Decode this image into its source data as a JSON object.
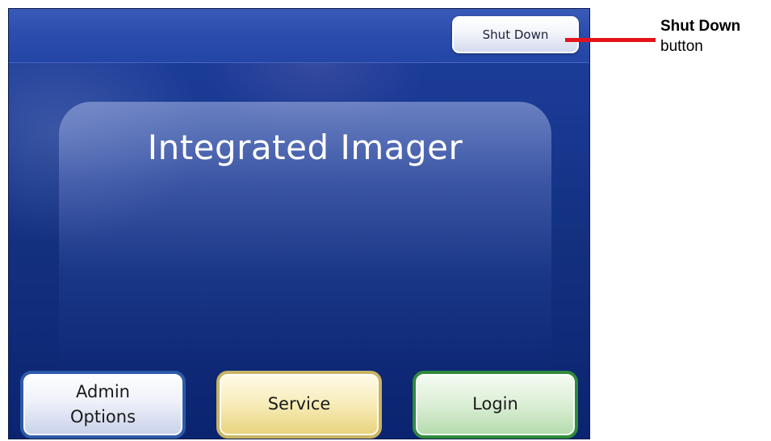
{
  "screen": {
    "title": "Integrated Imager",
    "shutdown_label": "Shut Down"
  },
  "buttons": {
    "admin_options": "Admin\nOptions",
    "service": "Service",
    "login": "Login"
  },
  "callout": {
    "title": "Shut Down",
    "subtitle": "button",
    "line_color": "#e5121c"
  },
  "colors": {
    "screen_background": "#1a3a95",
    "admin_border": "#2d5aa8",
    "service_border": "#c8b463",
    "login_border": "#2f8a3a"
  }
}
